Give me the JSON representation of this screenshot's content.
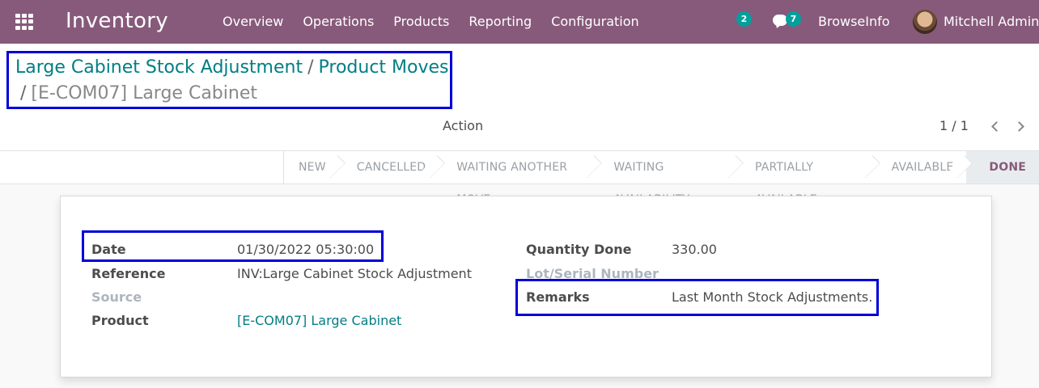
{
  "navbar": {
    "app_name": "Inventory",
    "menu": [
      "Overview",
      "Operations",
      "Products",
      "Reporting",
      "Configuration"
    ],
    "activity_count": "2",
    "messages_count": "7",
    "company": "BrowseInfo",
    "user": "Mitchell Admin"
  },
  "breadcrumb": {
    "link1": "Large Cabinet Stock Adjustment",
    "sep": "/",
    "link2": "Product Moves",
    "current": "[E-COM07] Large Cabinet"
  },
  "control": {
    "action_label": "Action",
    "pager": "1 / 1"
  },
  "status_stages": [
    "NEW",
    "CANCELLED",
    "WAITING ANOTHER MOVE",
    "WAITING AVAILABILITY",
    "PARTIALLY AVAILABLE",
    "AVAILABLE",
    "DONE"
  ],
  "active_stage": "DONE",
  "form": {
    "left": {
      "date_label": "Date",
      "date_value": "01/30/2022 05:30:00",
      "reference_label": "Reference",
      "reference_value": "INV:Large Cabinet Stock Adjustment",
      "source_label": "Source",
      "source_value": "",
      "product_label": "Product",
      "product_value": "[E-COM07] Large Cabinet"
    },
    "right": {
      "qty_label": "Quantity Done",
      "qty_value": "330.00",
      "lot_label": "Lot/Serial Number",
      "lot_value": "",
      "remarks_label": "Remarks",
      "remarks_value": "Last Month Stock Adjustments."
    }
  },
  "colors": {
    "navbar": "#875a7b",
    "link": "#017e84",
    "badge": "#00a09d",
    "highlight": "#0000d8"
  }
}
